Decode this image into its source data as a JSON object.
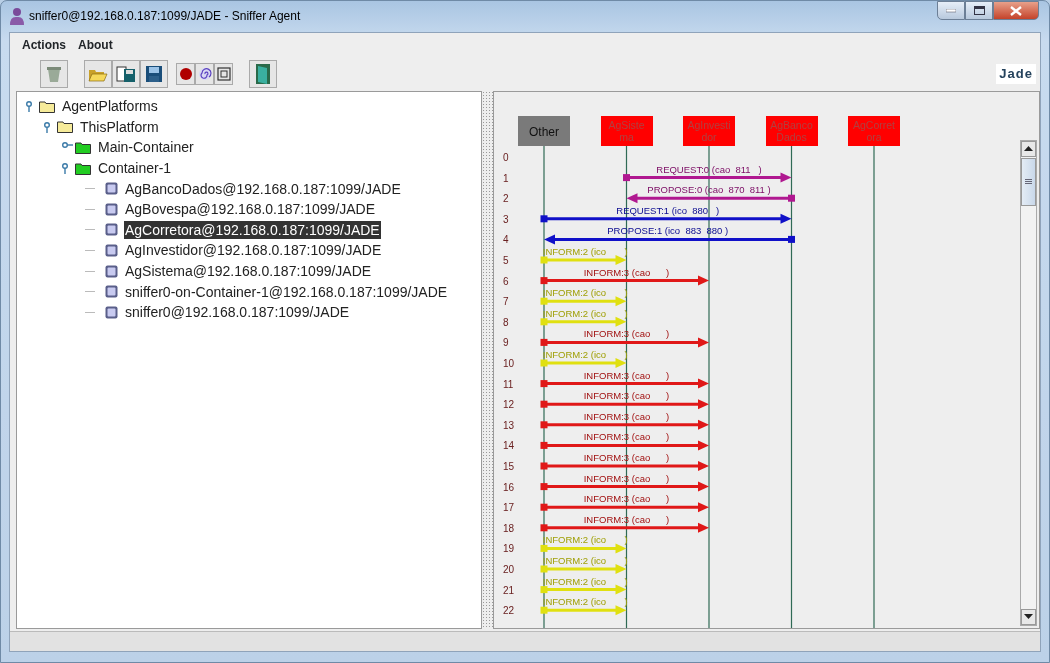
{
  "window": {
    "title": "sniffer0@192.168.0.187:1099/JADE - Sniffer Agent"
  },
  "menu": [
    {
      "label": "Actions"
    },
    {
      "label": "About"
    }
  ],
  "logo": {
    "text": "Jade"
  },
  "tree": [
    {
      "label": "AgentPlatforms",
      "kind": "platform",
      "expanded": true,
      "selected": false,
      "children": [
        {
          "label": "ThisPlatform",
          "kind": "platform",
          "expanded": true,
          "selected": false,
          "children": [
            {
              "label": "Main-Container",
              "kind": "container",
              "expanded": false,
              "selected": false
            },
            {
              "label": "Container-1",
              "kind": "container",
              "expanded": true,
              "selected": false,
              "children": [
                {
                  "label": "AgBancoDados@192.168.0.187:1099/JADE",
                  "kind": "agent",
                  "selected": false
                },
                {
                  "label": "AgBovespa@192.168.0.187:1099/JADE",
                  "kind": "agent",
                  "selected": false
                },
                {
                  "label": "AgCorretora@192.168.0.187:1099/JADE",
                  "kind": "agent",
                  "selected": true
                },
                {
                  "label": "AgInvestidor@192.168.0.187:1099/JADE",
                  "kind": "agent",
                  "selected": false
                },
                {
                  "label": "AgSistema@192.168.0.187:1099/JADE",
                  "kind": "agent",
                  "selected": false
                },
                {
                  "label": "sniffer0-on-Container-1@192.168.0.187:1099/JADE",
                  "kind": "agent",
                  "selected": false
                },
                {
                  "label": "sniffer0@192.168.0.187:1099/JADE",
                  "kind": "agent",
                  "selected": false
                }
              ]
            }
          ]
        }
      ]
    }
  ],
  "diagram": {
    "agents": [
      {
        "name": "Other",
        "kind": "other"
      },
      {
        "name": "AgSistema",
        "kind": "agent"
      },
      {
        "name": "AgInvestidor",
        "kind": "agent"
      },
      {
        "name": "AgBancoDados",
        "kind": "agent"
      },
      {
        "name": "AgCorretora",
        "kind": "agent"
      }
    ],
    "row_numbers": [
      "0",
      "1",
      "2",
      "3",
      "4",
      "5",
      "6",
      "7",
      "8",
      "9",
      "10",
      "11",
      "12",
      "13",
      "14",
      "15",
      "16",
      "17",
      "18",
      "19",
      "20",
      "21",
      "22"
    ],
    "messages": [
      {
        "label": "REQUEST:0 (cao  811   )",
        "kind": "sistema-to-banco",
        "color": "#b01890"
      },
      {
        "label": "PROPOSE:0 (cao  870  811 )",
        "kind": "banco-to-sistema",
        "color": "#b01890"
      },
      {
        "label": "REQUEST:1 (ico  880   )",
        "kind": "other-to-banco",
        "color": "#1010c8"
      },
      {
        "label": "PROPOSE:1 (ico  883  880 )",
        "kind": "banco-to-other",
        "color": "#1010c8"
      },
      {
        "label": "INFORM:2 (ico       )",
        "kind": "other-to-sistema",
        "color": "#e0e010"
      },
      {
        "label": "INFORM:3 (cao      )",
        "kind": "other-to-investidor",
        "color": "#e01818"
      },
      {
        "label": "INFORM:2 (ico       )",
        "kind": "other-to-sistema",
        "color": "#e0e010"
      },
      {
        "label": "INFORM:2 (ico       )",
        "kind": "other-to-sistema",
        "color": "#e0e010"
      },
      {
        "label": "INFORM:3 (cao      )",
        "kind": "other-to-investidor",
        "color": "#e01818"
      },
      {
        "label": "INFORM:2 (ico       )",
        "kind": "other-to-sistema",
        "color": "#e0e010"
      },
      {
        "label": "INFORM:3 (cao      )",
        "kind": "other-to-investidor",
        "color": "#e01818"
      },
      {
        "label": "INFORM:3 (cao      )",
        "kind": "other-to-investidor",
        "color": "#e01818"
      },
      {
        "label": "INFORM:3 (cao      )",
        "kind": "other-to-investidor",
        "color": "#e01818"
      },
      {
        "label": "INFORM:3 (cao      )",
        "kind": "other-to-investidor",
        "color": "#e01818"
      },
      {
        "label": "INFORM:3 (cao      )",
        "kind": "other-to-investidor",
        "color": "#e01818"
      },
      {
        "label": "INFORM:3 (cao      )",
        "kind": "other-to-investidor",
        "color": "#e01818"
      },
      {
        "label": "INFORM:3 (cao      )",
        "kind": "other-to-investidor",
        "color": "#e01818"
      },
      {
        "label": "INFORM:3 (cao      )",
        "kind": "other-to-investidor",
        "color": "#e01818"
      },
      {
        "label": "INFORM:2 (ico       )",
        "kind": "other-to-sistema",
        "color": "#e0e010"
      },
      {
        "label": "INFORM:2 (ico       )",
        "kind": "other-to-sistema",
        "color": "#e0e010"
      },
      {
        "label": "INFORM:2 (ico       )",
        "kind": "other-to-sistema",
        "color": "#e0e010"
      },
      {
        "label": "INFORM:2 (ico       )",
        "kind": "other-to-sistema",
        "color": "#e0e010"
      }
    ]
  }
}
